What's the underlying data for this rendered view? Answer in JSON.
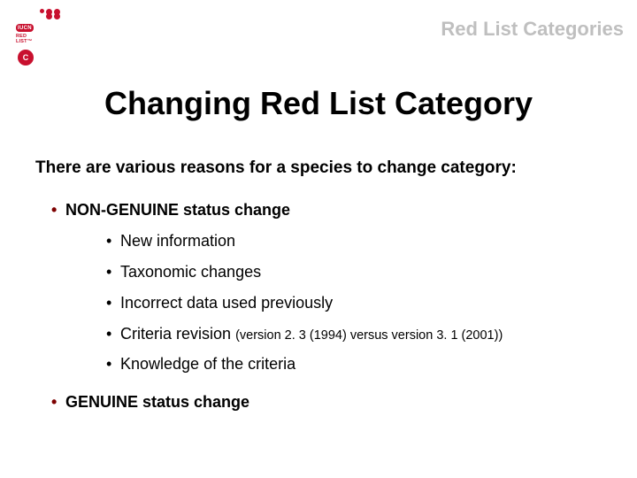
{
  "header": {
    "label": "Red List Categories"
  },
  "logo": {
    "line1": "IUCN",
    "line2": "RED",
    "line3": "LIST",
    "tm": "™",
    "small": "C"
  },
  "title": "Changing Red List Category",
  "intro": "There are various reasons for a species to change category:",
  "bullets": {
    "nongenuine": {
      "label": "NON-GENUINE status change",
      "items": [
        "New information",
        "Taxonomic changes",
        "Incorrect data used previously",
        "Criteria revision",
        "Knowledge of the criteria"
      ],
      "criteria_note": "(version 2. 3 (1994) versus version 3. 1 (2001))"
    },
    "genuine": {
      "label": "GENUINE status change"
    }
  }
}
